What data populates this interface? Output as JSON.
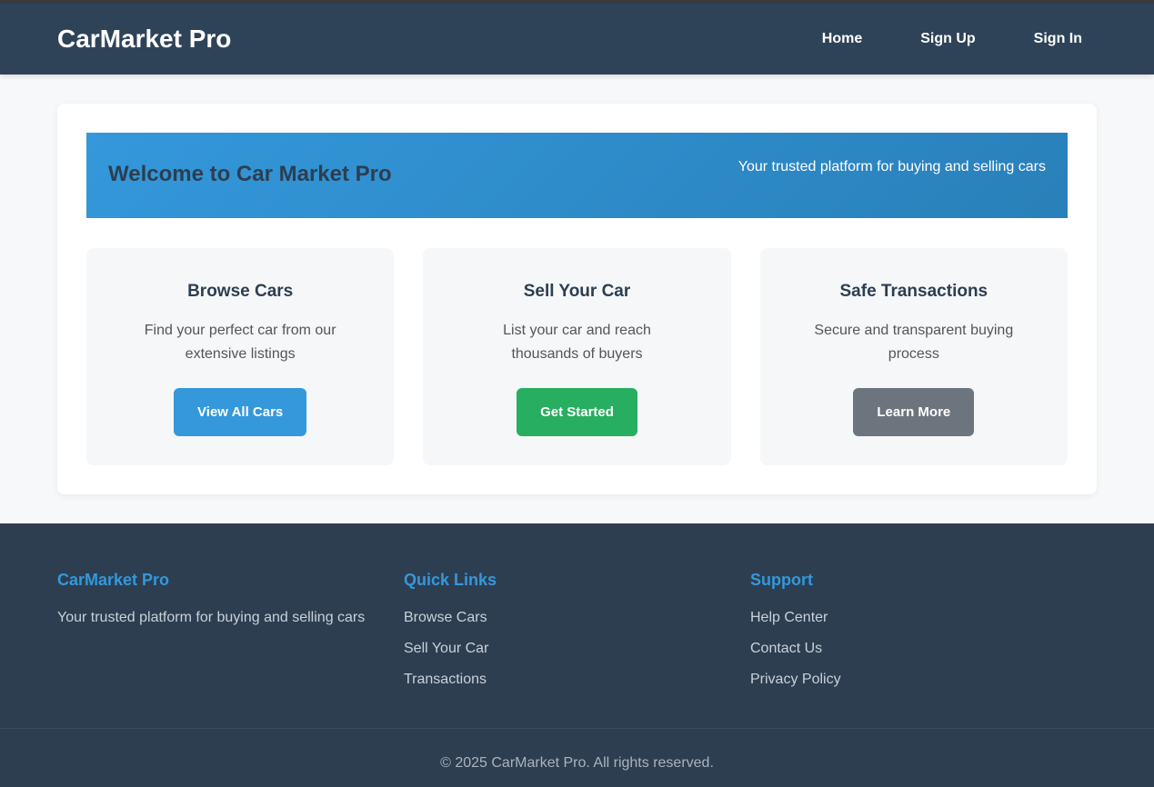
{
  "header": {
    "logo": "CarMarket Pro",
    "nav": [
      "Home",
      "Sign Up",
      "Sign In"
    ]
  },
  "hero": {
    "title": "Welcome to Car Market Pro",
    "tagline": "Your trusted platform for buying and selling cars"
  },
  "cards": [
    {
      "title": "Browse Cars",
      "text": "Find your perfect car from our extensive listings",
      "button": "View All Cars",
      "color": "#3498db"
    },
    {
      "title": "Sell Your Car",
      "text": "List your car and reach thousands of buyers",
      "button": "Get Started",
      "color": "#27ae60"
    },
    {
      "title": "Safe Transactions",
      "text": "Secure and transparent buying process",
      "button": "Learn More",
      "color": "#6c757d"
    }
  ],
  "footer": {
    "brand": {
      "title": "CarMarket Pro",
      "text": "Your trusted platform for buying and selling cars"
    },
    "quick_links": {
      "title": "Quick Links",
      "items": [
        "Browse Cars",
        "Sell Your Car",
        "Transactions"
      ]
    },
    "support": {
      "title": "Support",
      "items": [
        "Help Center",
        "Contact Us",
        "Privacy Policy"
      ]
    },
    "copyright": "© 2025 CarMarket Pro. All rights reserved."
  }
}
